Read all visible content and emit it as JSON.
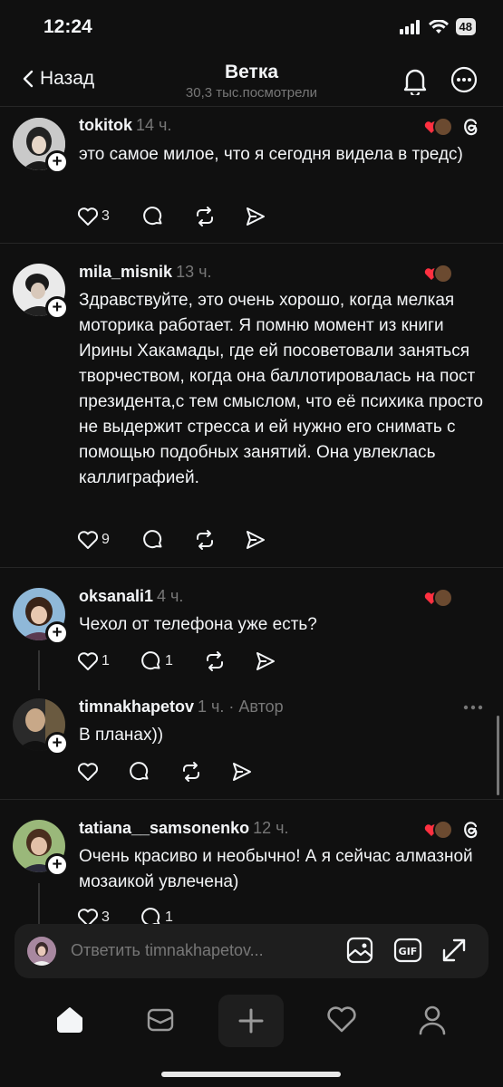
{
  "status": {
    "time": "12:24",
    "battery": "48"
  },
  "header": {
    "back_label": "Назад",
    "title": "Ветка",
    "subtitle": "30,3 тыс.посмотрели"
  },
  "posts": [
    {
      "username": "tokitok",
      "time": "14 ч.",
      "text": "это самое милое, что я сегодня видела в тредс)",
      "likes": "3",
      "replies": ""
    },
    {
      "username": "mila_misnik",
      "time": "13 ч.",
      "text": "Здравствуйте, это очень хорошо, когда мелкая моторика работает. Я помню момент из книги Ирины Хакамады, где ей посоветовали заняться творчеством, когда она баллотировалась на пост президента,с тем смыслом, что её психика просто не выдержит стресса и ей нужно его снимать с помощью подобных занятий. Она увлеклась каллиграфией.",
      "likes": "9",
      "replies": ""
    },
    {
      "username": "oksanali1",
      "time": "4 ч.",
      "text": "Чехол от телефона уже есть?",
      "likes": "1",
      "replies": "1"
    },
    {
      "username": "timnakhapetov",
      "time": "1 ч. · Автор",
      "text": "В планах))",
      "likes": "",
      "replies": ""
    },
    {
      "username": "tatiana__samsonenko",
      "time": "12 ч.",
      "text": "Очень красиво и необычно! А я сейчас алмазной мозаикой увлечена)",
      "likes": "3",
      "replies": "1"
    }
  ],
  "reply_bar": {
    "placeholder": "Ответить timnakhapetov..."
  },
  "icons": {
    "tools": [
      "image-icon",
      "gif-icon",
      "expand-icon"
    ],
    "tabs": [
      "home-icon",
      "inbox-icon",
      "plus-icon",
      "heart-icon",
      "profile-icon"
    ]
  },
  "colors": {
    "background": "#101010",
    "like_red": "#ff3040",
    "secondary_text": "#777777"
  }
}
